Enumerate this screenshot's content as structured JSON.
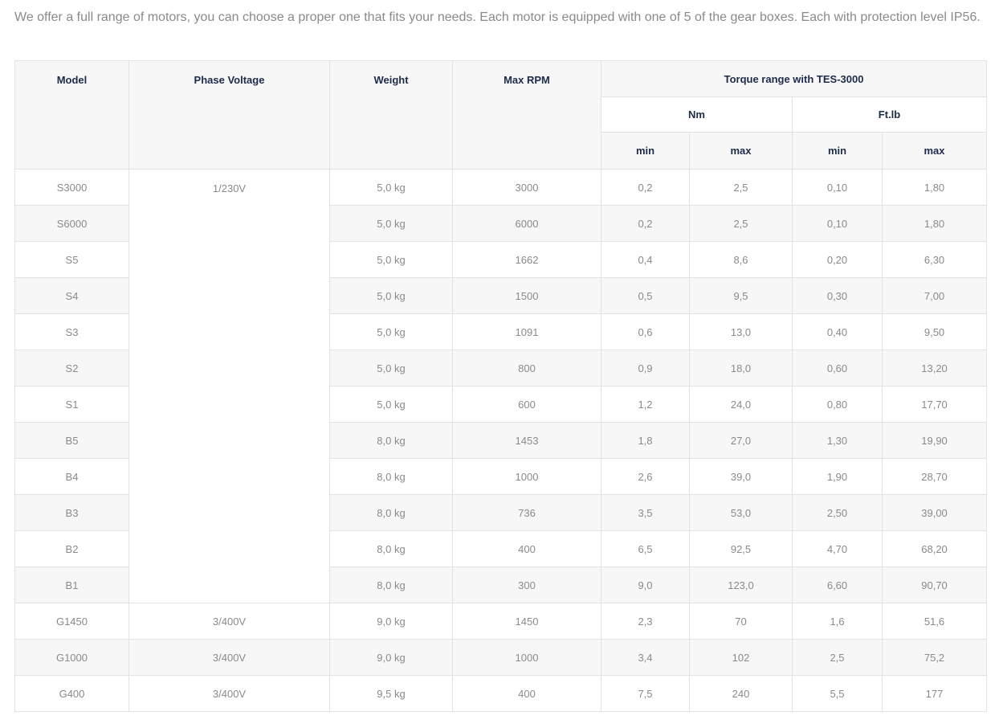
{
  "intro": {
    "text": "We offer a full range of motors, you can choose a proper one that fits your needs. Each motor is equipped with one of 5 of the gear boxes. Each with protection level IP56."
  },
  "table": {
    "headers": {
      "model": "Model",
      "phase_voltage": "Phase Voltage",
      "weight": "Weight",
      "max_rpm": "Max RPM",
      "torque_range": "Torque range with TES-3000",
      "nm": "Nm",
      "ftlb": "Ft.lb",
      "nm_min": "min",
      "nm_max": "max",
      "ftlb_min": "min",
      "ftlb_max": "max"
    },
    "merged_voltage": "1/230V",
    "rows": [
      {
        "model": "S3000",
        "voltage": "1/230V",
        "weight": "5,0 kg",
        "rpm": "3000",
        "nm_min": "0,2",
        "nm_max": "2,5",
        "ft_min": "0,10",
        "ft_max": "1,80"
      },
      {
        "model": "S6000",
        "voltage": "",
        "weight": "5,0 kg",
        "rpm": "6000",
        "nm_min": "0,2",
        "nm_max": "2,5",
        "ft_min": "0,10",
        "ft_max": "1,80"
      },
      {
        "model": "S5",
        "voltage": "",
        "weight": "5,0 kg",
        "rpm": "1662",
        "nm_min": "0,4",
        "nm_max": "8,6",
        "ft_min": "0,20",
        "ft_max": "6,30"
      },
      {
        "model": "S4",
        "voltage": "",
        "weight": "5,0 kg",
        "rpm": "1500",
        "nm_min": "0,5",
        "nm_max": "9,5",
        "ft_min": "0,30",
        "ft_max": "7,00"
      },
      {
        "model": "S3",
        "voltage": "",
        "weight": "5,0 kg",
        "rpm": "1091",
        "nm_min": "0,6",
        "nm_max": "13,0",
        "ft_min": "0,40",
        "ft_max": "9,50"
      },
      {
        "model": "S2",
        "voltage": "",
        "weight": "5,0 kg",
        "rpm": "800",
        "nm_min": "0,9",
        "nm_max": "18,0",
        "ft_min": "0,60",
        "ft_max": "13,20"
      },
      {
        "model": "S1",
        "voltage": "",
        "weight": "5,0 kg",
        "rpm": "600",
        "nm_min": "1,2",
        "nm_max": "24,0",
        "ft_min": "0,80",
        "ft_max": "17,70"
      },
      {
        "model": "B5",
        "voltage": "",
        "weight": "8,0 kg",
        "rpm": "1453",
        "nm_min": "1,8",
        "nm_max": "27,0",
        "ft_min": "1,30",
        "ft_max": "19,90"
      },
      {
        "model": "B4",
        "voltage": "",
        "weight": "8,0 kg",
        "rpm": "1000",
        "nm_min": "2,6",
        "nm_max": "39,0",
        "ft_min": "1,90",
        "ft_max": "28,70"
      },
      {
        "model": "B3",
        "voltage": "",
        "weight": "8,0 kg",
        "rpm": "736",
        "nm_min": "3,5",
        "nm_max": "53,0",
        "ft_min": "2,50",
        "ft_max": "39,00"
      },
      {
        "model": "B2",
        "voltage": "",
        "weight": "8,0 kg",
        "rpm": "400",
        "nm_min": "6,5",
        "nm_max": "92,5",
        "ft_min": "4,70",
        "ft_max": "68,20"
      },
      {
        "model": "B1",
        "voltage": "",
        "weight": "8,0 kg",
        "rpm": "300",
        "nm_min": "9,0",
        "nm_max": "123,0",
        "ft_min": "6,60",
        "ft_max": "90,70"
      },
      {
        "model": "G1450",
        "voltage": "3/400V",
        "weight": "9,0 kg",
        "rpm": "1450",
        "nm_min": "2,3",
        "nm_max": "70",
        "ft_min": "1,6",
        "ft_max": "51,6"
      },
      {
        "model": "G1000",
        "voltage": "3/400V",
        "weight": "9,0 kg",
        "rpm": "1000",
        "nm_min": "3,4",
        "nm_max": "102",
        "ft_min": "2,5",
        "ft_max": "75,2"
      },
      {
        "model": "G400",
        "voltage": "3/400V",
        "weight": "9,5 kg",
        "rpm": "400",
        "nm_min": "7,5",
        "nm_max": "240",
        "ft_min": "5,5",
        "ft_max": "177"
      }
    ]
  }
}
